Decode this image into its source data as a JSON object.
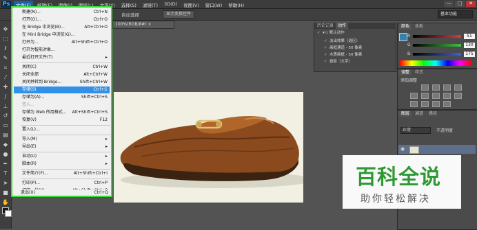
{
  "menubar": {
    "logo": "Ps",
    "items": [
      "文件(F)",
      "编辑(E)",
      "图像(I)",
      "图层(L)",
      "文字(Y)",
      "选择(S)",
      "滤镜(T)",
      "3D(D)",
      "视图(V)",
      "窗口(W)",
      "帮助(H)"
    ],
    "window_buttons": [
      "—",
      "□",
      "✕"
    ]
  },
  "options_bar": {
    "auto_select": "自动选择",
    "show_transform": "显示变换控件",
    "workspace": "基本功能"
  },
  "document_tab": "100%(RGB/8#) ×",
  "file_menu": {
    "items": [
      {
        "label": "新建(N)...",
        "shortcut": "Ctrl+N"
      },
      {
        "label": "打开(O)...",
        "shortcut": "Ctrl+O"
      },
      {
        "label": "在 Bridge 中浏览(B)...",
        "shortcut": "Alt+Ctrl+O"
      },
      {
        "label": "在 Mini Bridge 中浏览(G)...",
        "shortcut": ""
      },
      {
        "label": "打开为...",
        "shortcut": "Alt+Shift+Ctrl+O"
      },
      {
        "label": "打开为智能对象...",
        "shortcut": ""
      },
      {
        "label": "最近打开文件(T)",
        "shortcut": "",
        "submenu": true
      },
      {
        "label": "关闭(C)",
        "shortcut": "Ctrl+W"
      },
      {
        "label": "关闭全部",
        "shortcut": "Alt+Ctrl+W"
      },
      {
        "label": "关闭并转到 Bridge...",
        "shortcut": "Shift+Ctrl+W"
      },
      {
        "label": "存储(S)",
        "shortcut": "Ctrl+S",
        "highlighted": true
      },
      {
        "label": "存储为(A)...",
        "shortcut": "Shift+Ctrl+S"
      },
      {
        "label": "签入...",
        "shortcut": "",
        "disabled": true
      },
      {
        "label": "存储为 Web 所用格式...",
        "shortcut": "Alt+Shift+Ctrl+S"
      },
      {
        "label": "恢复(V)",
        "shortcut": "F12"
      },
      {
        "label": "置入(L)...",
        "shortcut": ""
      },
      {
        "label": "导入(M)",
        "shortcut": "",
        "submenu": true
      },
      {
        "label": "导出(E)",
        "shortcut": "",
        "submenu": true
      },
      {
        "label": "自动(U)",
        "shortcut": "",
        "submenu": true
      },
      {
        "label": "脚本(R)",
        "shortcut": "",
        "submenu": true
      },
      {
        "label": "文件简介(F)...",
        "shortcut": "Alt+Shift+Ctrl+I"
      },
      {
        "label": "打印(P)...",
        "shortcut": "Ctrl+P"
      },
      {
        "label": "打印一份(Y)",
        "shortcut": "Alt+Shift+Ctrl+P"
      },
      {
        "label": "退出(X)",
        "shortcut": "Ctrl+Q"
      }
    ]
  },
  "actions_panel": {
    "tabs": [
      "历史记录",
      "动作"
    ],
    "rows": [
      "默认动作",
      "淡出效果（选区）",
      "画框通道 - 50 像素",
      "木质画框 - 50 像素",
      "投影（文字）"
    ]
  },
  "color_panel": {
    "tabs": [
      "颜色",
      "色板"
    ],
    "channels": [
      {
        "label": "R",
        "value": "51",
        "color": "#d04040"
      },
      {
        "label": "G",
        "value": "130",
        "color": "#40c040"
      },
      {
        "label": "B",
        "value": "175",
        "color": "#4060e0"
      }
    ]
  },
  "adjust_panel": {
    "tabs": [
      "调整",
      "样式"
    ],
    "title": "添加调整"
  },
  "layers_panel": {
    "tabs": [
      "图层",
      "通道",
      "路径"
    ],
    "blend": "正常",
    "opacity": "不透明度"
  },
  "watermark": {
    "title": "百科全说",
    "subtitle": "助你轻松解决"
  }
}
